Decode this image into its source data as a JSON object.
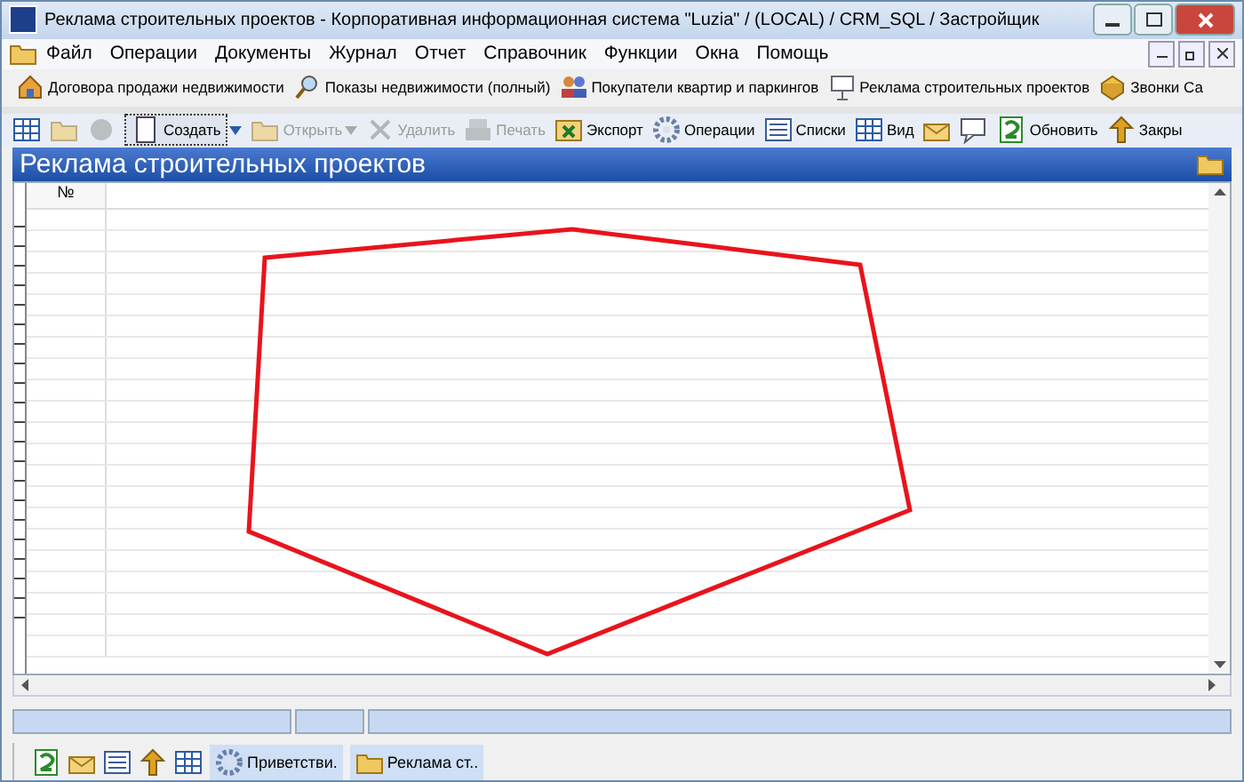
{
  "window": {
    "title": "Реклама строительных проектов - Корпоративная информационная система \"Luzia\" / (LOCAL) / CRM_SQL / Застройщик"
  },
  "menu": [
    "Файл",
    "Операции",
    "Документы",
    "Журнал",
    "Отчет",
    "Справочник",
    "Функции",
    "Окна",
    "Помощь"
  ],
  "quick_bar": [
    {
      "label": "Договора продажи недвижимости",
      "kind": "house"
    },
    {
      "label": "Показы недвижимости (полный)",
      "kind": "search"
    },
    {
      "label": "Покупатели квартир и паркингов",
      "kind": "people"
    },
    {
      "label": "Реклама строительных проектов",
      "kind": "board"
    },
    {
      "label": "Звонки Са",
      "kind": "box"
    }
  ],
  "toolbar": [
    {
      "kind": "grid",
      "disabled": false
    },
    {
      "kind": "folder",
      "disabled": true
    },
    {
      "kind": "circle",
      "disabled": true
    },
    {
      "label": "Создать",
      "kind": "new",
      "disabled": false,
      "dropdown": true
    },
    {
      "label": "Открыть",
      "kind": "folder",
      "disabled": true,
      "dropdown": true
    },
    {
      "label": "Удалить",
      "kind": "cross",
      "disabled": true
    },
    {
      "label": "Печать",
      "kind": "printer",
      "disabled": true
    },
    {
      "label": "Экспорт",
      "kind": "excel",
      "disabled": false
    },
    {
      "label": "Операции",
      "kind": "gear",
      "disabled": false
    },
    {
      "label": "Списки",
      "kind": "list",
      "disabled": false
    },
    {
      "label": "Вид",
      "kind": "grid",
      "disabled": false
    },
    {
      "kind": "mail",
      "disabled": false
    },
    {
      "kind": "chat",
      "disabled": false
    },
    {
      "label": "Обновить",
      "kind": "refresh",
      "disabled": false
    },
    {
      "label": "Закры",
      "kind": "exit",
      "disabled": false
    }
  ],
  "panel": {
    "title": "Реклама строительных проектов"
  },
  "table": {
    "columns": [
      "№"
    ]
  },
  "taskbar": {
    "items": [
      {
        "label": "Приветстви.",
        "kind": "gear"
      },
      {
        "label": "Реклама ст..",
        "kind": "folder"
      }
    ]
  }
}
